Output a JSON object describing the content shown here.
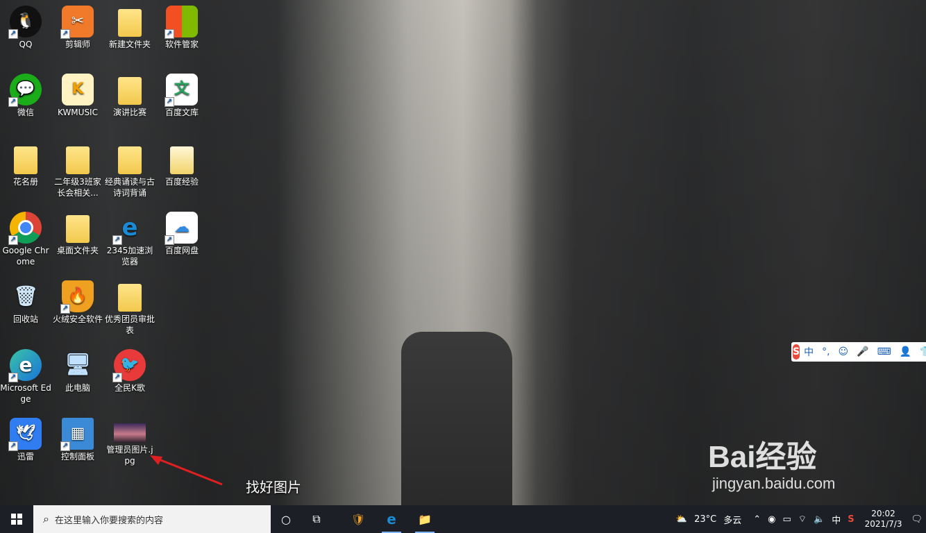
{
  "desktop": {
    "icons": [
      {
        "label": "QQ"
      },
      {
        "label": "剪辑师"
      },
      {
        "label": "新建文件夹"
      },
      {
        "label": "软件管家"
      },
      {
        "label": "微信"
      },
      {
        "label": "KWMUSIC"
      },
      {
        "label": "演讲比赛"
      },
      {
        "label": "百度文库"
      },
      {
        "label": "花名册"
      },
      {
        "label": "二年级3班家长会相关..."
      },
      {
        "label": "经典诵读与古诗词背诵"
      },
      {
        "label": "百度经验"
      },
      {
        "label": "Google Chrome"
      },
      {
        "label": "桌面文件夹"
      },
      {
        "label": "2345加速浏览器"
      },
      {
        "label": "百度网盘"
      },
      {
        "label": "回收站"
      },
      {
        "label": "火绒安全软件"
      },
      {
        "label": "优秀团员审批表"
      },
      {
        "label": "Microsoft Edge"
      },
      {
        "label": "此电脑"
      },
      {
        "label": "全民K歌"
      },
      {
        "label": "迅雷"
      },
      {
        "label": "控制面板"
      },
      {
        "label": "管理员图片.jpg"
      }
    ]
  },
  "annotation": {
    "text": "找好图片"
  },
  "watermark": {
    "brand": "Bai经验",
    "url": "jingyan.baidu.com"
  },
  "ime": {
    "items": [
      "中",
      "°,",
      "☺",
      "🎤",
      "⌨",
      "👤",
      "👕"
    ]
  },
  "taskbar": {
    "search_placeholder": "在这里输入你要搜索的内容",
    "weather_temp": "23°C",
    "weather_desc": "多云",
    "ime_mode": "中",
    "time": "20:02",
    "date": "2021/7/3"
  }
}
